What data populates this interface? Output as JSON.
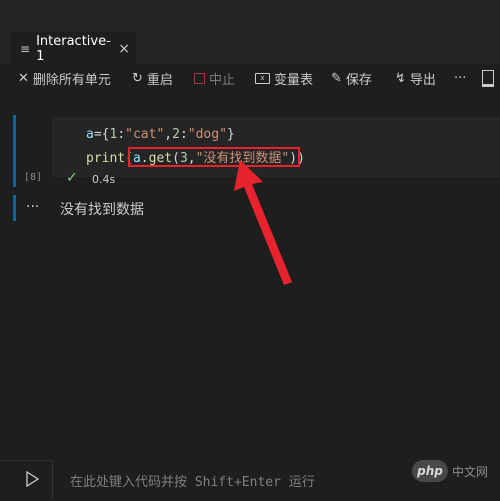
{
  "tab": {
    "title": "Interactive-1",
    "icon": "notebook-icon"
  },
  "toolbar": {
    "clear_all": "删除所有单元",
    "restart": "重启",
    "interrupt": "中止",
    "variables": "变量表",
    "save": "保存",
    "export": "导出",
    "more": "···"
  },
  "cell": {
    "execution_count": "[8]",
    "status_time": "0.4s",
    "code_lines": [
      "a={1:\"cat\",2:\"dog\"}",
      "print(a.get(3,\"没有找到数据\"))"
    ]
  },
  "output": {
    "text": "没有找到数据"
  },
  "input": {
    "placeholder": "在此处键入代码并按 Shift+Enter 运行"
  },
  "watermark": {
    "logo": "php",
    "text": "中文网"
  },
  "colors": {
    "accent_bar": "#0e639c",
    "annotation": "#e8232d",
    "success": "#89d185",
    "background": "#1e1e1e"
  }
}
